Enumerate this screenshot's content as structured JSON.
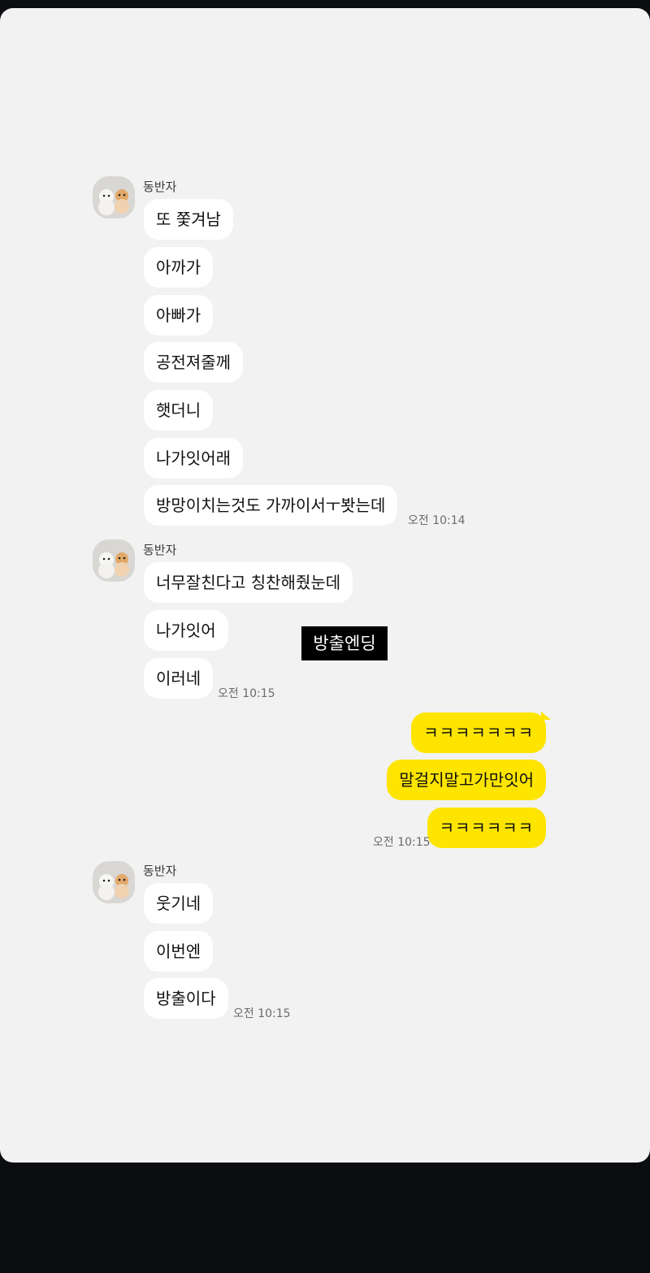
{
  "chat": {
    "groups": [
      {
        "sender": "동반자",
        "messages": [
          "또 쫓겨남",
          "아까가",
          "아빠가",
          "공전져줄께",
          "햇더니",
          "나가잇어래",
          "방망이치는것도 가까이서ㅜ봣는데"
        ],
        "time": "오전 10:14"
      },
      {
        "sender": "동반자",
        "messages": [
          "너무잘친다고 칭찬해줬눈데",
          "나가잇어",
          "이러네"
        ],
        "time": "오전 10:15"
      },
      {
        "outgoing": true,
        "messages": [
          "ㅋㅋㅋㅋㅋㅋㅋ",
          "말걸지말고가만잇어",
          "ㅋㅋㅋㅋㅋㅋ"
        ],
        "time": "오전 10:15"
      },
      {
        "sender": "동반자",
        "messages": [
          "웃기네",
          "이번엔",
          "방출이다"
        ],
        "time": "오전 10:15"
      }
    ]
  },
  "overlay_caption": "방출엔딩",
  "colors": {
    "background": "#f2f2f2",
    "incoming_bubble": "#ffffff",
    "outgoing_bubble": "#fee500"
  }
}
